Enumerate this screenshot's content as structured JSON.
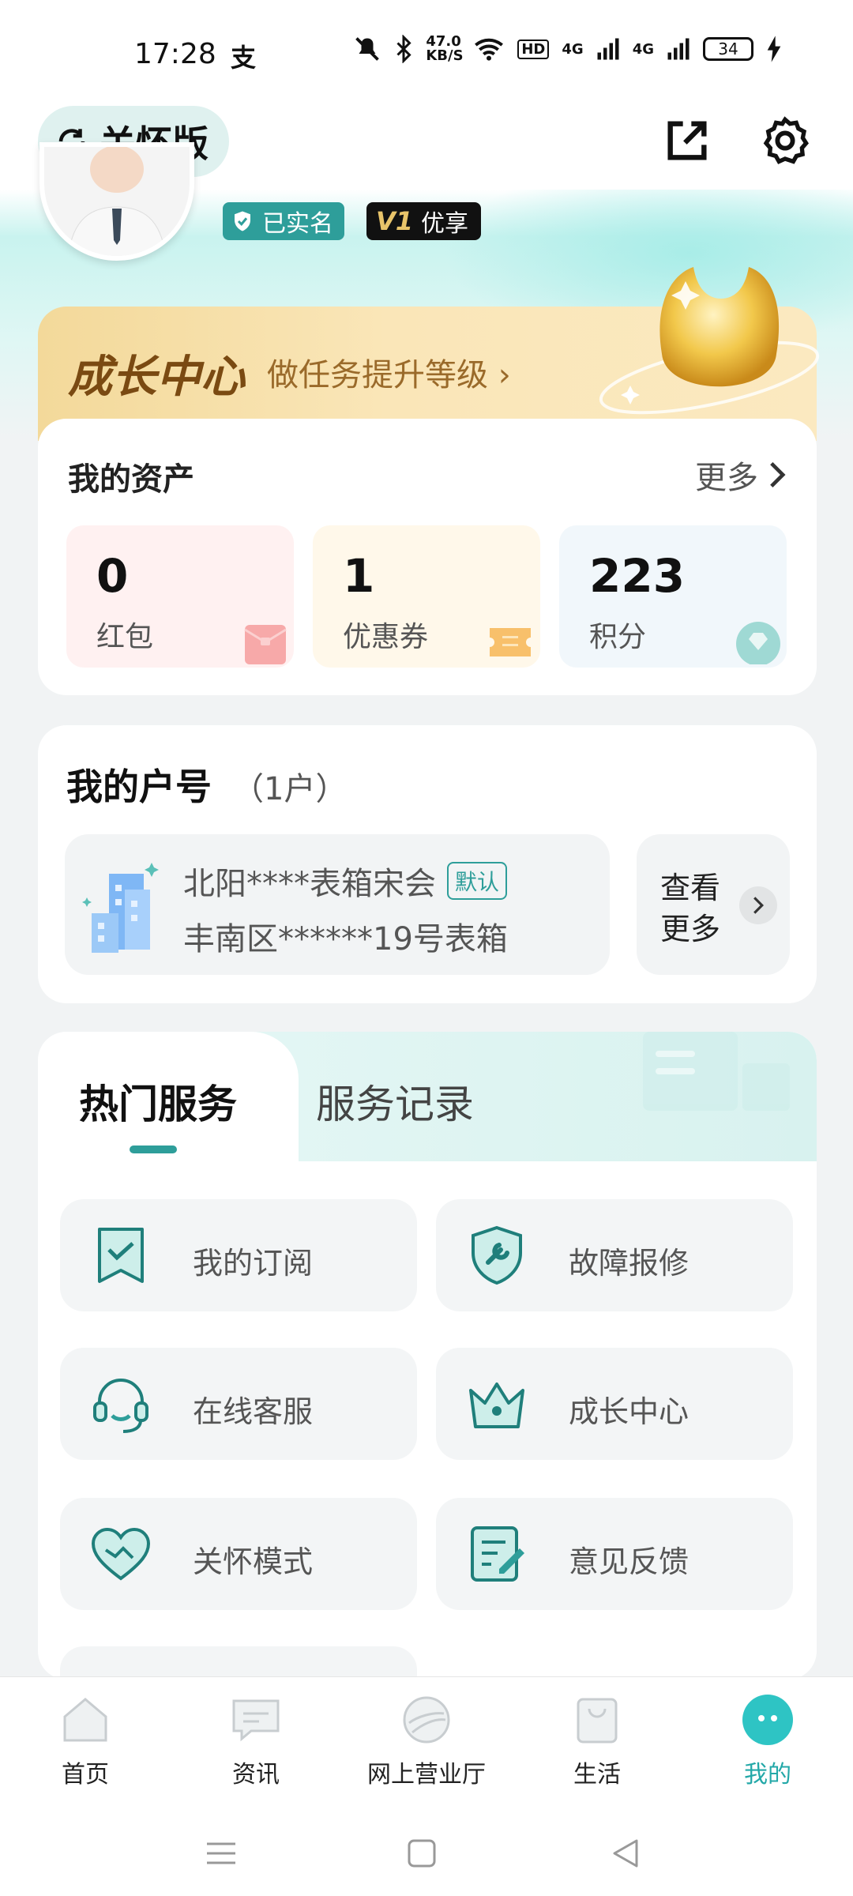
{
  "status_bar": {
    "time": "17:28",
    "app_indicator": "支",
    "net_speed": "47.0 KB/S",
    "signal_1": "4G",
    "signal_2": "4G",
    "battery": "34"
  },
  "header": {
    "care_mode_label": "关怀版",
    "icons": [
      "refresh-icon",
      "share-icon",
      "gear-icon"
    ]
  },
  "profile": {
    "verified_label": "已实名",
    "vip_level": "V1",
    "vip_label": "优享"
  },
  "growth": {
    "title": "成长中心",
    "subtitle": "做任务提升等级 ›"
  },
  "assets": {
    "title": "我的资产",
    "more": "更多",
    "items": [
      {
        "value": "0",
        "label": "红包",
        "icon": "red-envelope-icon"
      },
      {
        "value": "1",
        "label": "优惠券",
        "icon": "coupon-icon"
      },
      {
        "value": "223",
        "label": "积分",
        "icon": "diamond-icon"
      }
    ]
  },
  "account": {
    "title": "我的户号",
    "count": "（1户）",
    "name": "北阳****表箱宋会",
    "default_tag": "默认",
    "address": "丰南区******19号表箱",
    "more_line1": "查看",
    "more_line2": "更多"
  },
  "services": {
    "tab_active": "热门服务",
    "tab_other": "服务记录",
    "items": [
      {
        "label": "我的订阅",
        "icon": "subscription-icon"
      },
      {
        "label": "故障报修",
        "icon": "repair-shield-icon"
      },
      {
        "label": "在线客服",
        "icon": "headset-icon"
      },
      {
        "label": "成长中心",
        "icon": "crown-icon"
      },
      {
        "label": "关怀模式",
        "icon": "heart-handshake-icon"
      },
      {
        "label": "意见反馈",
        "icon": "feedback-edit-icon"
      }
    ]
  },
  "bottom_nav": {
    "items": [
      {
        "label": "首页",
        "icon": "home-icon"
      },
      {
        "label": "资讯",
        "icon": "news-chat-icon"
      },
      {
        "label": "网上营业厅",
        "icon": "globe-icon"
      },
      {
        "label": "生活",
        "icon": "shopping-bag-icon"
      },
      {
        "label": "我的",
        "icon": "profile-face-icon",
        "active": true
      }
    ]
  },
  "colors": {
    "accent": "#2e9e9a",
    "nav_active": "#23a8a8",
    "growth_title": "#7a4a12"
  }
}
